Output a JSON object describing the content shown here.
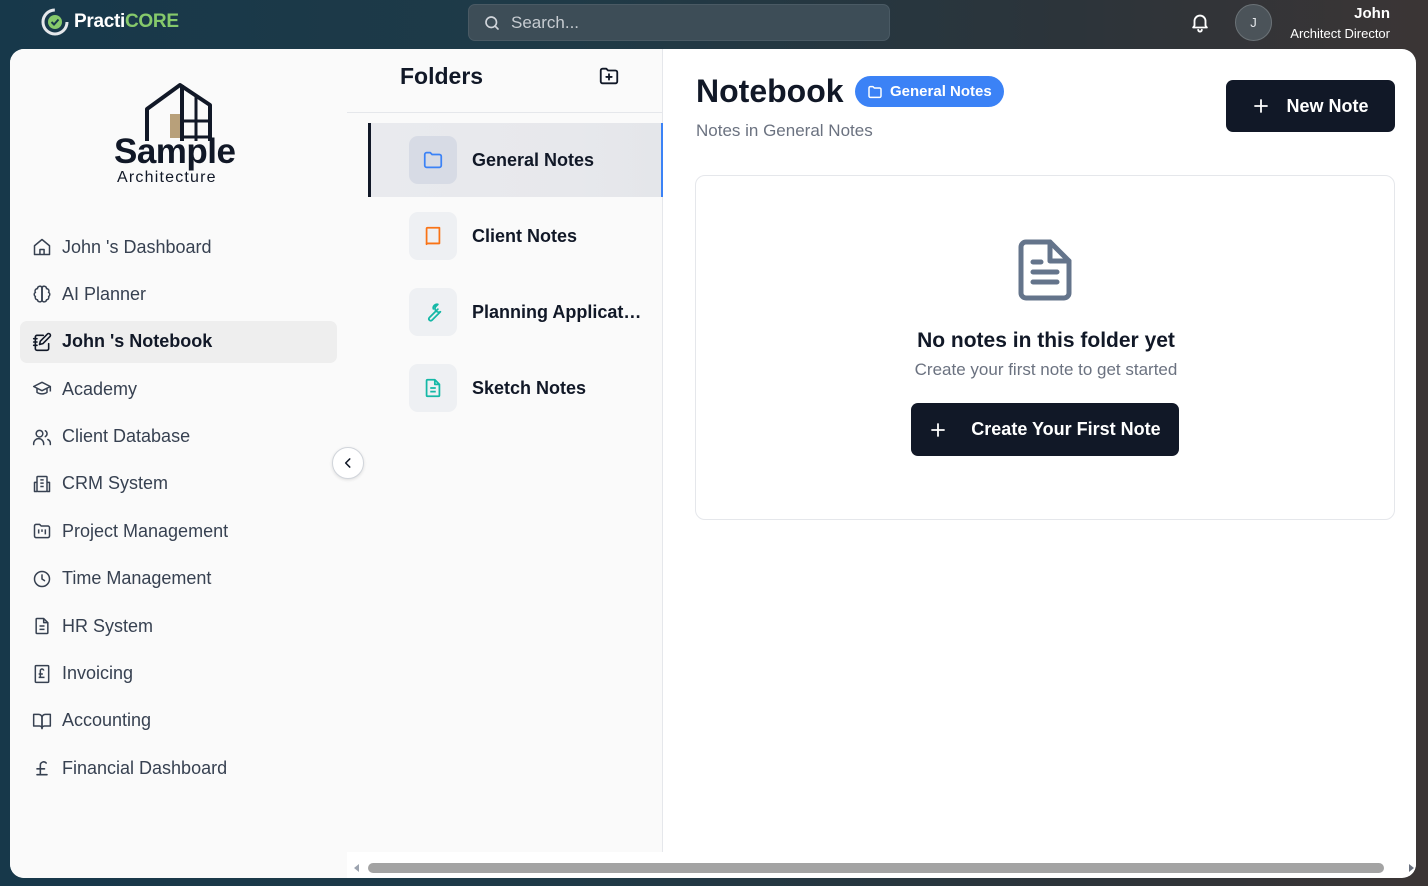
{
  "app": {
    "brand_prefix": "Practi",
    "brand_suffix": "CORE",
    "accent_color": "#86c96b"
  },
  "search": {
    "placeholder": "Search..."
  },
  "user": {
    "initial": "J",
    "name": "John",
    "role": "Architect Director"
  },
  "company": {
    "name": "Sample",
    "tagline": "Architecture"
  },
  "sidebar": {
    "items": [
      {
        "label": "John 's Dashboard",
        "icon": "home-icon",
        "active": false
      },
      {
        "label": "AI Planner",
        "icon": "brain-icon",
        "active": false
      },
      {
        "label": "John 's Notebook",
        "icon": "notebook-pen-icon",
        "active": true
      },
      {
        "label": "Academy",
        "icon": "graduation-cap-icon",
        "active": false
      },
      {
        "label": "Client Database",
        "icon": "users-icon",
        "active": false
      },
      {
        "label": "CRM System",
        "icon": "building-icon",
        "active": false
      },
      {
        "label": "Project Management",
        "icon": "folder-kanban-icon",
        "active": false
      },
      {
        "label": "Time Management",
        "icon": "clock-icon",
        "active": false
      },
      {
        "label": "HR System",
        "icon": "file-text-icon",
        "active": false
      },
      {
        "label": "Invoicing",
        "icon": "receipt-pound-icon",
        "active": false
      },
      {
        "label": "Accounting",
        "icon": "book-open-icon",
        "active": false
      },
      {
        "label": "Financial Dashboard",
        "icon": "pound-sign-icon",
        "active": false
      }
    ]
  },
  "folders": {
    "title": "Folders",
    "items": [
      {
        "label": "General Notes",
        "icon": "folder-icon",
        "color": "#3b82f6",
        "active": true
      },
      {
        "label": "Client Notes",
        "icon": "book-icon",
        "color": "#f97316",
        "active": false
      },
      {
        "label": "Planning Applications",
        "icon": "wrench-icon",
        "color": "#14b8a6",
        "active": false
      },
      {
        "label": "Sketch Notes",
        "icon": "file-text-icon",
        "color": "#14b8a6",
        "active": false
      }
    ]
  },
  "main": {
    "title": "Notebook",
    "folder_badge": "General Notes",
    "subtitle": "Notes in General Notes",
    "new_note_label": "New Note",
    "empty": {
      "title": "No notes in this folder yet",
      "subtitle": "Create your first note to get started",
      "cta_label": "Create Your First Note"
    }
  }
}
